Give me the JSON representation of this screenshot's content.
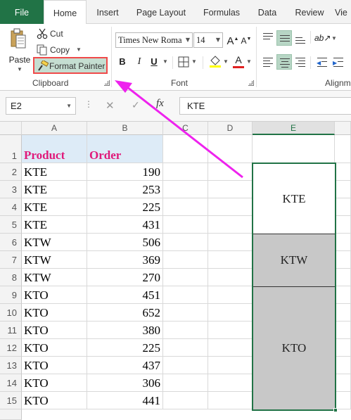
{
  "ribbon": {
    "tabs": [
      "File",
      "Home",
      "Insert",
      "Page Layout",
      "Formulas",
      "Data",
      "Review",
      "Vie"
    ],
    "active_tab": "Home",
    "clipboard": {
      "paste_label": "Paste",
      "cut_label": "Cut",
      "copy_label": "Copy",
      "format_painter_label": "Format Painter",
      "group_label": "Clipboard"
    },
    "font": {
      "font_name": "Times New Roma",
      "font_size": "14",
      "bold": "B",
      "italic": "I",
      "underline": "U",
      "font_color_letter": "A",
      "font_color": "#e02020",
      "highlight_color": "#ffff00",
      "group_label": "Font"
    },
    "alignment": {
      "group_label": "Alignm"
    }
  },
  "formula_bar": {
    "name_box": "E2",
    "fx_label": "fx",
    "content": "KTE"
  },
  "sheet": {
    "columns": [
      "A",
      "B",
      "C",
      "D",
      "E"
    ],
    "selected_column": "E",
    "header_row": {
      "product": "Product",
      "order": "Order"
    },
    "row_numbers": [
      "1",
      "2",
      "3",
      "4",
      "5",
      "6",
      "7",
      "8",
      "9",
      "10",
      "11",
      "12",
      "13",
      "14",
      "15"
    ],
    "rows": [
      {
        "product": "KTE",
        "order": "190"
      },
      {
        "product": "KTE",
        "order": "253"
      },
      {
        "product": "KTE",
        "order": "225"
      },
      {
        "product": "KTE",
        "order": "431"
      },
      {
        "product": "KTW",
        "order": "506"
      },
      {
        "product": "KTW",
        "order": "369"
      },
      {
        "product": "KTW",
        "order": "270"
      },
      {
        "product": "KTO",
        "order": "451"
      },
      {
        "product": "KTO",
        "order": "652"
      },
      {
        "product": "KTO",
        "order": "380"
      },
      {
        "product": "KTO",
        "order": "225"
      },
      {
        "product": "KTO",
        "order": "437"
      },
      {
        "product": "KTO",
        "order": "306"
      },
      {
        "product": "KTO",
        "order": "441"
      }
    ],
    "merged_column_e": [
      {
        "label": "KTE",
        "fill": "#ffffff"
      },
      {
        "label": "KTW",
        "fill": "#c8c8c8"
      },
      {
        "label": "KTO",
        "fill": "#c8c8c8"
      }
    ],
    "header_fill": "#ddebf7",
    "header_text_color": "#e0197a",
    "selection_color": "#217346"
  },
  "annotation": {
    "arrow_color": "#ee22ee"
  }
}
